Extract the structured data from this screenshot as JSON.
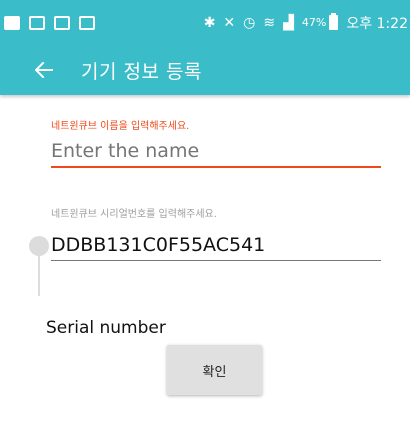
{
  "status_bar": {
    "battery": "47%",
    "time": "오후 1:22",
    "left_icons": [
      "notification-box-icon",
      "notification-box-icon",
      "gallery-icon",
      "image-icon"
    ],
    "right_icons": [
      "bluetooth-icon",
      "mute-icon",
      "alarm-icon",
      "wifi-icon",
      "signal-icon"
    ]
  },
  "app_bar": {
    "title": "기기 정보 등록",
    "color": "#3bbdc9"
  },
  "form": {
    "name_hint": "네트윈큐브 이름을 입력해주세요.",
    "name_placeholder": "Enter the name",
    "serial_hint": "네트윈큐브 시리얼번호를 입력해주세요.",
    "serial_value": "DDBB131C0F55AC541",
    "serial_label": "Serial number",
    "confirm_label": "확인",
    "accent_color": "#f0491a"
  }
}
